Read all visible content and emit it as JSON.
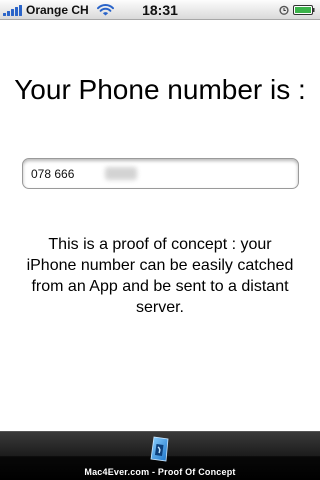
{
  "status_bar": {
    "carrier": "Orange CH",
    "time": "18:31",
    "icons": [
      "signal-icon",
      "wifi-icon",
      "alarm-icon",
      "battery-icon"
    ]
  },
  "main": {
    "headline": "Your Phone number is :",
    "phone_field": {
      "value": "078 666"
    },
    "message": "This is a proof of concept : your iPhone number can be easily catched from an App and be sent to a distant server."
  },
  "footer": {
    "logo_icon": "mac4ever-logo-icon",
    "label": "Mac4Ever.com - Proof Of Concept"
  },
  "colors": {
    "signal": "#2a64c9",
    "battery": "#3bb34a",
    "footer_bg": "#1c1c1c"
  }
}
